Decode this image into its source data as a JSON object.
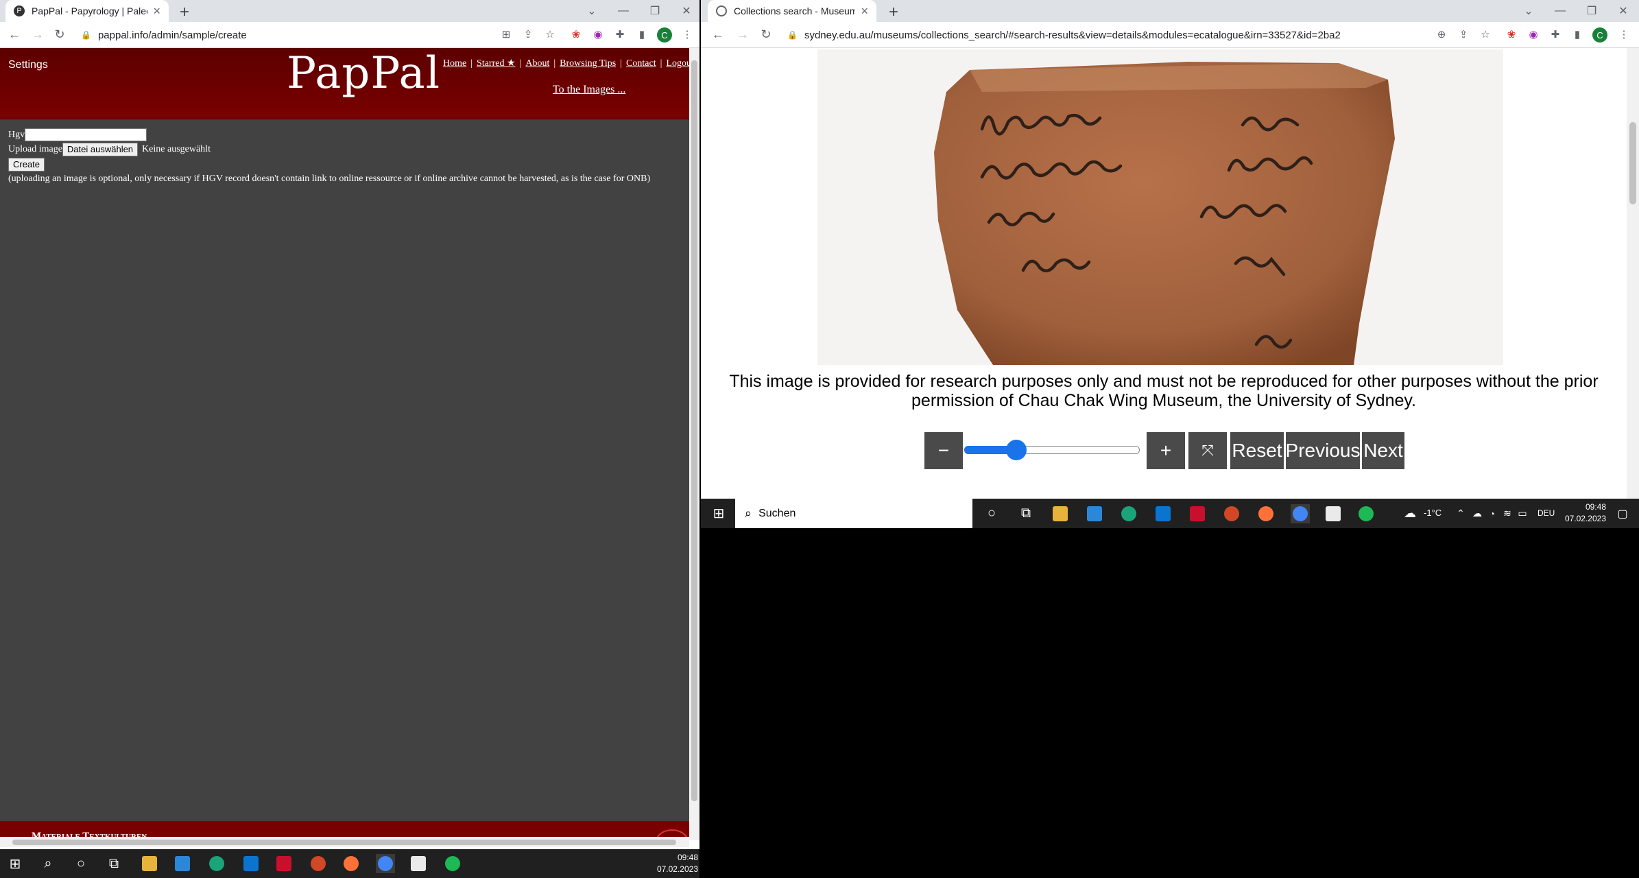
{
  "left": {
    "tab": {
      "title": "PapPal - Papyrology | Paleograph...",
      "favicon": "P"
    },
    "url": "pappal.info/admin/sample/create",
    "page": {
      "settings": "Settings",
      "logo": "PapPal",
      "nav": [
        "Home",
        "Starred ★",
        "About",
        "Browsing Tips",
        "Contact",
        "Logou"
      ],
      "to_images": "To the Images ...",
      "hgv_label": "Hgv",
      "upload_label": "Upload image",
      "file_button": "Datei auswählen",
      "file_status": "Keine ausgewählt",
      "create_button": "Create",
      "note": "(uploading an image is optional, only necessary if HGV record doesn't contain link to online ressource or if online archive cannot be harvested, as is the case for ONB)",
      "footer": "Materiale Textkulturen"
    },
    "taskbar": {
      "time": "09:48",
      "date": "07.02.2023"
    }
  },
  "right": {
    "tab": {
      "title": "Collections search - Museums - T"
    },
    "url": "sydney.edu.au/museums/collections_search/#search-results&view=details&modules=ecatalogue&irn=33527&id=2ba2",
    "caption": "This image is provided for research purposes only and must not be reproduced for other purposes without the prior permission of Chau Chak Wing Museum, the University of Sydney.",
    "controls": {
      "minus": "−",
      "plus": "+",
      "reset": "Reset",
      "previous": "Previous",
      "next": "Next",
      "zoom_level": 0.27
    },
    "taskbar": {
      "search": "Suchen",
      "weather": "-1°C",
      "lang": "DEU",
      "time": "09:48",
      "date": "07.02.2023"
    }
  },
  "colors": {
    "pappal_red": "#7a0000",
    "pappal_bg": "#424242",
    "slider_blue": "#1a73e8",
    "taskbar": "#202020"
  }
}
